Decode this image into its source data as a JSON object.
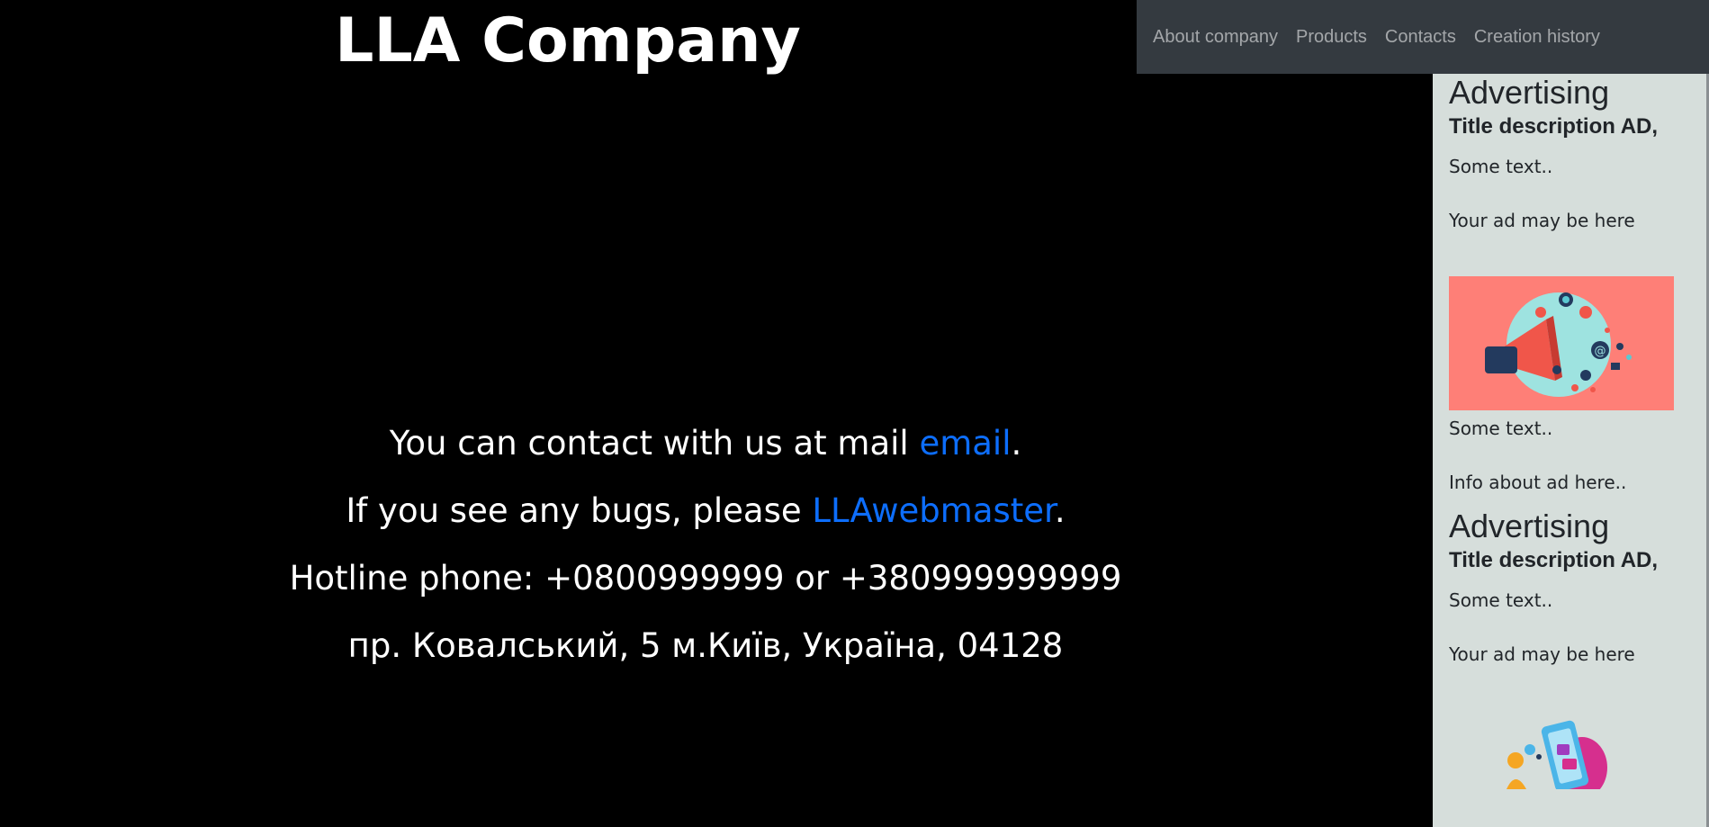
{
  "header": {
    "title": "LLA Company"
  },
  "nav": {
    "items": [
      {
        "label": "About company"
      },
      {
        "label": "Products"
      },
      {
        "label": "Contacts"
      },
      {
        "label": "Creation history"
      }
    ]
  },
  "contact": {
    "line1_prefix": "You can contact with us at mail ",
    "line1_link": "email",
    "line1_suffix": ".",
    "line2_prefix": "If you see any bugs, please ",
    "line2_link": "LLAwebmaster",
    "line2_suffix": ".",
    "line3": "Hotline phone: +0800999999 or +380999999999",
    "line4": "пр. Ковалський, 5 м.Київ, Україна, 04128"
  },
  "sidebar": {
    "ads": [
      {
        "heading": "Advertising",
        "subtitle": "Title description AD,",
        "text1": "Some text..",
        "text2": "Your ad may be here",
        "image_icon": "megaphone-ad-image",
        "image_caption": "Some text..",
        "info": "Info about ad here.."
      },
      {
        "heading": "Advertising",
        "subtitle": "Title description AD,",
        "text1": "Some text..",
        "text2": "Your ad may be here",
        "image_icon": "social-media-phone-image"
      }
    ]
  },
  "colors": {
    "background": "#000000",
    "navbar": "#343a40",
    "link": "#0d6efd",
    "sidebar": "#d6dedb",
    "ad_image_bg": "#fe7f77"
  }
}
